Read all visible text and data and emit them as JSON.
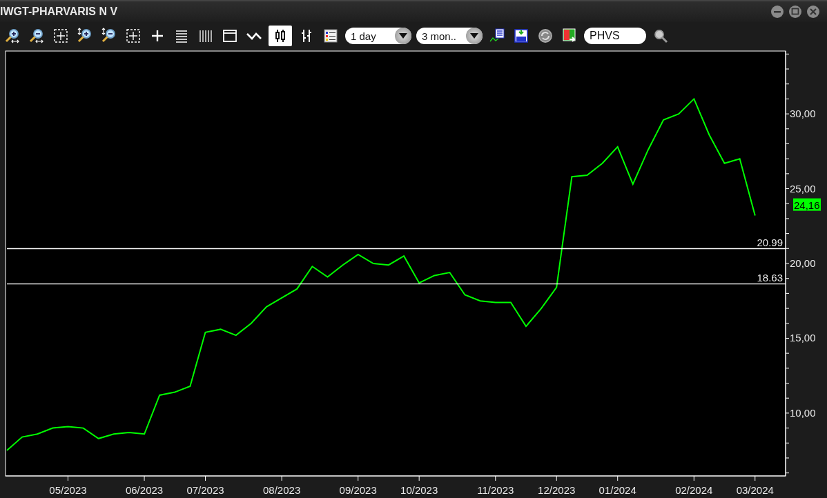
{
  "window": {
    "title": "IWGT-PHARVARIS N V"
  },
  "toolbar": [
    {
      "kind": "zoom-in-h"
    },
    {
      "kind": "zoom-out-h"
    },
    {
      "kind": "fit"
    },
    {
      "kind": "zoom-in-v"
    },
    {
      "kind": "zoom-out-v"
    },
    {
      "kind": "collapse"
    },
    {
      "kind": "crosshair"
    },
    {
      "kind": "hlines"
    },
    {
      "kind": "vlines"
    },
    {
      "kind": "window"
    },
    {
      "kind": "line",
      "selected": false
    },
    {
      "kind": "candle",
      "selected": true
    },
    {
      "kind": "ohlc",
      "selected": false
    },
    {
      "kind": "legend"
    },
    {
      "kind": "dropdown",
      "value": "1 day"
    },
    {
      "kind": "dropdown",
      "value": "3 mon.."
    },
    {
      "kind": "indicator"
    },
    {
      "kind": "save"
    },
    {
      "kind": "refresh"
    },
    {
      "kind": "export"
    },
    {
      "kind": "search-field",
      "value": "PHVS"
    },
    {
      "kind": "search"
    }
  ],
  "chart": {
    "chart_data": {
      "type": "line",
      "legend": "lower right",
      "ylim": [
        5.8,
        34.2
      ],
      "categories": [
        null,
        null,
        null,
        null,
        "05/2023",
        null,
        null,
        null,
        null,
        "06/2023",
        null,
        null,
        null,
        "07/2023",
        null,
        null,
        null,
        null,
        "08/2023",
        null,
        null,
        null,
        null,
        "09/2023",
        null,
        null,
        null,
        "10/2023",
        null,
        null,
        null,
        null,
        "11/2023",
        null,
        null,
        null,
        "12/2023",
        null,
        null,
        null,
        "01/2024",
        null,
        null,
        null,
        null,
        "02/2024",
        null,
        null,
        null,
        "03/2024",
        null,
        null
      ],
      "yticks": [
        {
          "value": 10,
          "label": "10,00"
        },
        {
          "value": 15,
          "label": "15,00"
        },
        {
          "value": 20,
          "label": "20,00"
        },
        {
          "value": 25,
          "label": "25,00"
        },
        {
          "value": 30,
          "label": "30,00"
        }
      ],
      "series": [
        {
          "color": "#00ff00",
          "values": [
            7.5,
            8.4,
            8.6,
            9.0,
            9.1,
            9.0,
            8.3,
            8.6,
            8.7,
            8.6,
            11.2,
            11.4,
            11.8,
            15.4,
            15.6,
            15.2,
            16.0,
            17.1,
            17.7,
            18.3,
            19.8,
            19.1,
            19.9,
            20.6,
            20.0,
            19.9,
            20.5,
            18.7,
            19.2,
            19.4,
            17.9,
            17.5,
            17.4,
            17.4,
            15.8,
            17.0,
            18.4,
            25.8,
            25.9,
            26.7,
            27.8,
            25.3,
            27.6,
            29.6,
            30.0,
            31.0,
            28.6,
            26.7,
            27.0,
            23.2,
            null,
            null
          ]
        },
        {
          "name": "20.99",
          "color": "#ffffff",
          "values": [
            20.99,
            20.99,
            20.99,
            20.99,
            20.99,
            20.99,
            20.99,
            20.99,
            20.99,
            20.99,
            20.99,
            20.99,
            20.99,
            20.99,
            20.99,
            20.99,
            20.99,
            20.99,
            20.99,
            20.99,
            20.99,
            20.99,
            20.99,
            20.99,
            20.99,
            20.99,
            20.99,
            20.99,
            20.99,
            20.99,
            20.99,
            20.99,
            20.99,
            20.99,
            20.99,
            20.99,
            20.99,
            20.99,
            20.99,
            20.99,
            20.99,
            20.99,
            20.99,
            20.99,
            20.99,
            20.99,
            20.99,
            20.99,
            20.99,
            20.99,
            20.99,
            20.99
          ]
        },
        {
          "name": "18.63",
          "color": "#ffffff",
          "values": [
            18.63,
            18.63,
            18.63,
            18.63,
            18.63,
            18.63,
            18.63,
            18.63,
            18.63,
            18.63,
            18.63,
            18.63,
            18.63,
            18.63,
            18.63,
            18.63,
            18.63,
            18.63,
            18.63,
            18.63,
            18.63,
            18.63,
            18.63,
            18.63,
            18.63,
            18.63,
            18.63,
            18.63,
            18.63,
            18.63,
            18.63,
            18.63,
            18.63,
            18.63,
            18.63,
            18.63,
            18.63,
            18.63,
            18.63,
            18.63,
            18.63,
            18.63,
            18.63,
            18.63,
            18.63,
            18.63,
            18.63,
            18.63,
            18.63,
            18.63,
            18.63,
            18.63
          ]
        }
      ]
    },
    "last_price": "24,16"
  }
}
